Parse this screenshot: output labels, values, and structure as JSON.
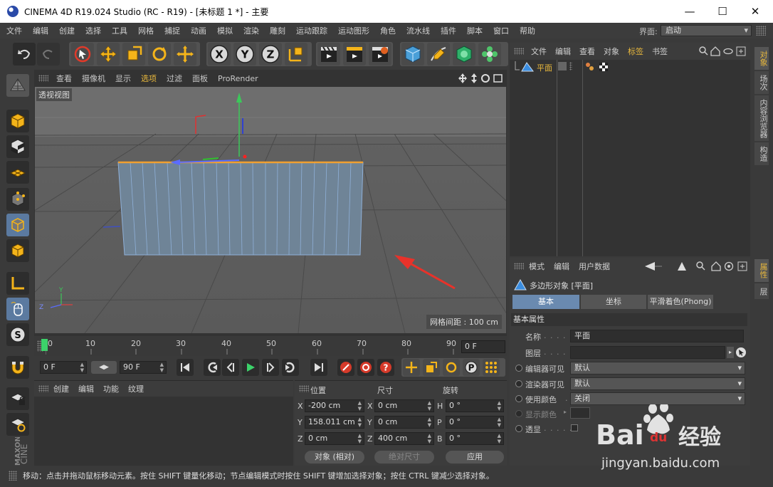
{
  "window": {
    "title": "CINEMA 4D R19.024 Studio (RC - R19) - [未标题 1 *] - 主要",
    "minimize": "—",
    "maximize": "☐",
    "close": "✕"
  },
  "menubar": {
    "items": [
      "文件",
      "编辑",
      "创建",
      "选择",
      "工具",
      "网格",
      "捕捉",
      "动画",
      "模拟",
      "渲染",
      "雕刻",
      "运动跟踪",
      "运动图形",
      "角色",
      "流水线",
      "插件",
      "脚本",
      "窗口",
      "帮助"
    ],
    "layout_label": "界面:",
    "layout_value": "启动"
  },
  "toolbar": {
    "axis_x": "X",
    "axis_y": "Y",
    "axis_z": "Z"
  },
  "viewport": {
    "menu": [
      "查看",
      "摄像机",
      "显示",
      "选项",
      "过滤",
      "面板",
      "ProRender"
    ],
    "active_menu": "选项",
    "label": "透视视图",
    "grid_spacing": "网格间距 : 100 cm",
    "axis_labels": {
      "y": "Y",
      "z": "Z"
    }
  },
  "timeline": {
    "ticks": [
      "0",
      "10",
      "20",
      "30",
      "40",
      "50",
      "60",
      "70",
      "80",
      "90"
    ],
    "current_frame": "0 F"
  },
  "transport": {
    "start_frame": "0 F",
    "end_frame": "90 F",
    "record_p": "P"
  },
  "material_manager": {
    "menu": [
      "创建",
      "编辑",
      "功能",
      "纹理"
    ]
  },
  "coordinates": {
    "headers": {
      "position": "位置",
      "size": "尺寸",
      "rotation": "旋转"
    },
    "rows": [
      {
        "axis": "X",
        "position": "-200 cm",
        "size_axis": "X",
        "size": "0 cm",
        "rot_axis": "H",
        "rotation": "0 °"
      },
      {
        "axis": "Y",
        "position": "158.011 cm",
        "size_axis": "Y",
        "size": "0 cm",
        "rot_axis": "P",
        "rotation": "0 °"
      },
      {
        "axis": "Z",
        "position": "0 cm",
        "size_axis": "Z",
        "size": "400 cm",
        "rot_axis": "B",
        "rotation": "0 °"
      }
    ],
    "mode": "对象 (相对)",
    "size_mode": "绝对尺寸",
    "apply": "应用"
  },
  "object_manager": {
    "menu": [
      "文件",
      "编辑",
      "查看",
      "对象",
      "标签",
      "书签"
    ],
    "active_menu": "标签",
    "objects": [
      {
        "name": "平面"
      }
    ]
  },
  "attribute_manager": {
    "menu": [
      "模式",
      "编辑",
      "用户数据"
    ],
    "object_title": "多边形对象 [平面]",
    "tabs": [
      "基本",
      "坐标",
      "平滑着色(Phong)"
    ],
    "active_tab": "基本",
    "section": "基本属性",
    "fields": {
      "name_label": "名称",
      "name_value": "平面",
      "layer_label": "图层",
      "editor_visible_label": "编辑器可见",
      "editor_visible_value": "默认",
      "render_visible_label": "渲染器可见",
      "render_visible_value": "默认",
      "use_color_label": "使用颜色",
      "use_color_value": "关闭",
      "display_color_label": "显示颜色",
      "xray_label": "透显"
    }
  },
  "right_tabs": [
    "对象",
    "场次",
    "内容浏览器",
    "构造",
    "属性",
    "层"
  ],
  "statusbar": {
    "text": "移动：点击并拖动鼠标移动元素。按住 SHIFT 键量化移动；节点编辑模式时按住 SHIFT 键增加选择对象；按住 CTRL 键减少选择对象。"
  },
  "watermark": {
    "brand": "Bai",
    "brand2": "du",
    "suffix": "经验",
    "url": "jingyan.baidu.com"
  },
  "colors": {
    "accent": "#e8b83c",
    "selection_blue": "#5b7aa0",
    "plane_edge": "#f0a030",
    "plane_fill": "#6f8497"
  }
}
